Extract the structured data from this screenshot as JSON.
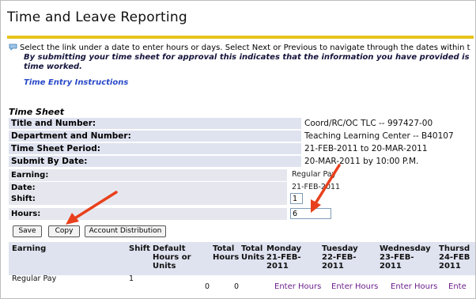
{
  "page": {
    "title": "Time and Leave Reporting",
    "info_text": "Select the link under a date to enter hours or days. Select Next or Previous to navigate through the dates within t",
    "info_bold_1": "By submitting your time sheet for approval this indicates that the information you have provided is",
    "info_bold_2": "time worked.",
    "instructions_link": "Time Entry Instructions"
  },
  "timesheet": {
    "section_title": "Time Sheet",
    "rows": [
      {
        "label": "Title and Number:",
        "value": "Coord/RC/OC TLC -- 997427-00"
      },
      {
        "label": "Department and Number:",
        "value": "Teaching Learning Center -- B40107"
      },
      {
        "label": "Time Sheet Period:",
        "value": "21-FEB-2011 to 20-MAR-2011"
      },
      {
        "label": "Submit By Date:",
        "value": "20-MAR-2011 by 10:00 P.M."
      }
    ]
  },
  "entry": {
    "earning_label": "Earning:",
    "earning_value": "Regular Pay",
    "date_label": "Date:",
    "date_value": "21-FEB-2011",
    "shift_label": "Shift:",
    "shift_value": "1",
    "hours_label": "Hours:",
    "hours_value": "6"
  },
  "buttons": {
    "save": "Save",
    "copy": "Copy",
    "account_distribution": "Account Distribution"
  },
  "grid": {
    "headers": {
      "earning": "Earning",
      "shift": "Shift",
      "default_hours_1": "Default",
      "default_hours_2": "Hours or",
      "default_hours_3": "Units",
      "total_hours_1": "Total",
      "total_hours_2": "Hours",
      "total_units_1": "Total",
      "total_units_2": "Units",
      "monday_1": "Monday",
      "monday_2": "21-FEB-",
      "monday_3": "2011",
      "tuesday_1": "Tuesday",
      "tuesday_2": "22-FEB-",
      "tuesday_3": "2011",
      "wednesday_1": "Wednesday",
      "wednesday_2": "23-FEB-",
      "wednesday_3": "2011",
      "thursday_1": "Thursd",
      "thursday_2": "24-FEB",
      "thursday_3": "2011"
    },
    "row": {
      "earning": "Regular Pay",
      "shift": "1",
      "total_hours": "0",
      "total_units": "0",
      "mon": "Enter Hours",
      "tue": "Enter Hours",
      "wed": "Enter Hours",
      "thu": "Ente"
    }
  },
  "colors": {
    "accent_bar": "#e7c31d",
    "label_bg": "#dfe2ef",
    "link": "#2848c8",
    "visited_link": "#6c1f8c",
    "arrow": "#e8401c"
  }
}
